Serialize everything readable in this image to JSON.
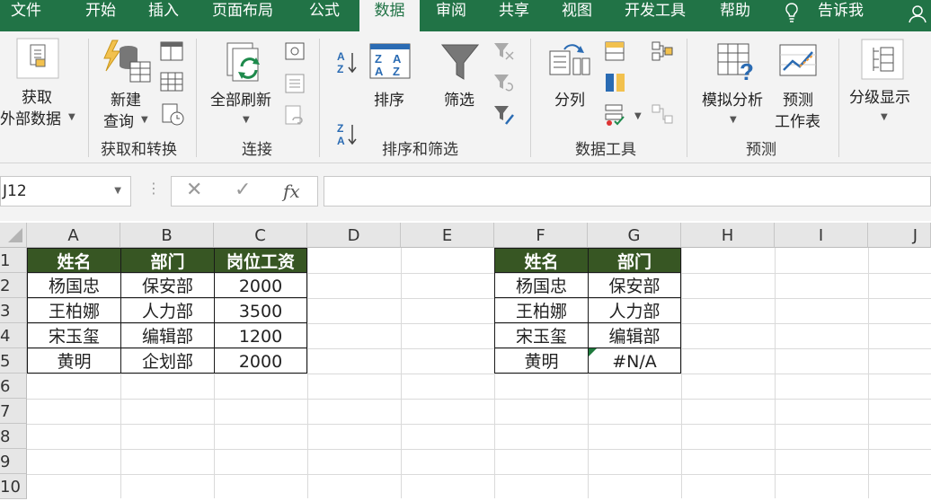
{
  "tabs": [
    "文件",
    "开始",
    "插入",
    "页面布局",
    "公式",
    "数据",
    "审阅",
    "共享",
    "视图",
    "开发工具",
    "帮助",
    "告诉我"
  ],
  "active_tab": "数据",
  "ribbon": {
    "get_external_l1": "获取",
    "get_external_l2": "外部数据",
    "new_query_l1": "新建",
    "new_query_l2": "查询",
    "refresh_all": "全部刷新",
    "sort": "排序",
    "filter": "筛选",
    "text_to_columns": "分列",
    "what_if": "模拟分析",
    "forecast_l1": "预测",
    "forecast_l2": "工作表",
    "outline": "分级显示",
    "groups": [
      "获取和转换",
      "连接",
      "排序和筛选",
      "数据工具",
      "预测"
    ]
  },
  "formula_bar": {
    "name_box": "J12",
    "cancel": "✕",
    "enter": "✓",
    "fx": "fx",
    "formula": ""
  },
  "columns": [
    "A",
    "B",
    "C",
    "D",
    "E",
    "F",
    "G",
    "H",
    "I",
    "J"
  ],
  "rows": [
    "1",
    "2",
    "3",
    "4",
    "5",
    "6",
    "7",
    "8",
    "9",
    "10"
  ],
  "table1": {
    "headers": [
      "姓名",
      "部门",
      "岗位工资"
    ],
    "rows": [
      [
        "杨国忠",
        "保安部",
        "2000"
      ],
      [
        "王柏娜",
        "人力部",
        "3500"
      ],
      [
        "宋玉玺",
        "编辑部",
        "1200"
      ],
      [
        "黄明",
        "企划部",
        "2000"
      ]
    ]
  },
  "table2": {
    "headers": [
      "姓名",
      "部门"
    ],
    "rows": [
      [
        "杨国忠",
        "保安部"
      ],
      [
        "王柏娜",
        "人力部"
      ],
      [
        "宋玉玺",
        "编辑部"
      ],
      [
        "黄明",
        "#N/A"
      ]
    ]
  },
  "colors": {
    "excel_green": "#217346",
    "header_fill": "#375623",
    "error_triangle": "#1e7a3c"
  }
}
